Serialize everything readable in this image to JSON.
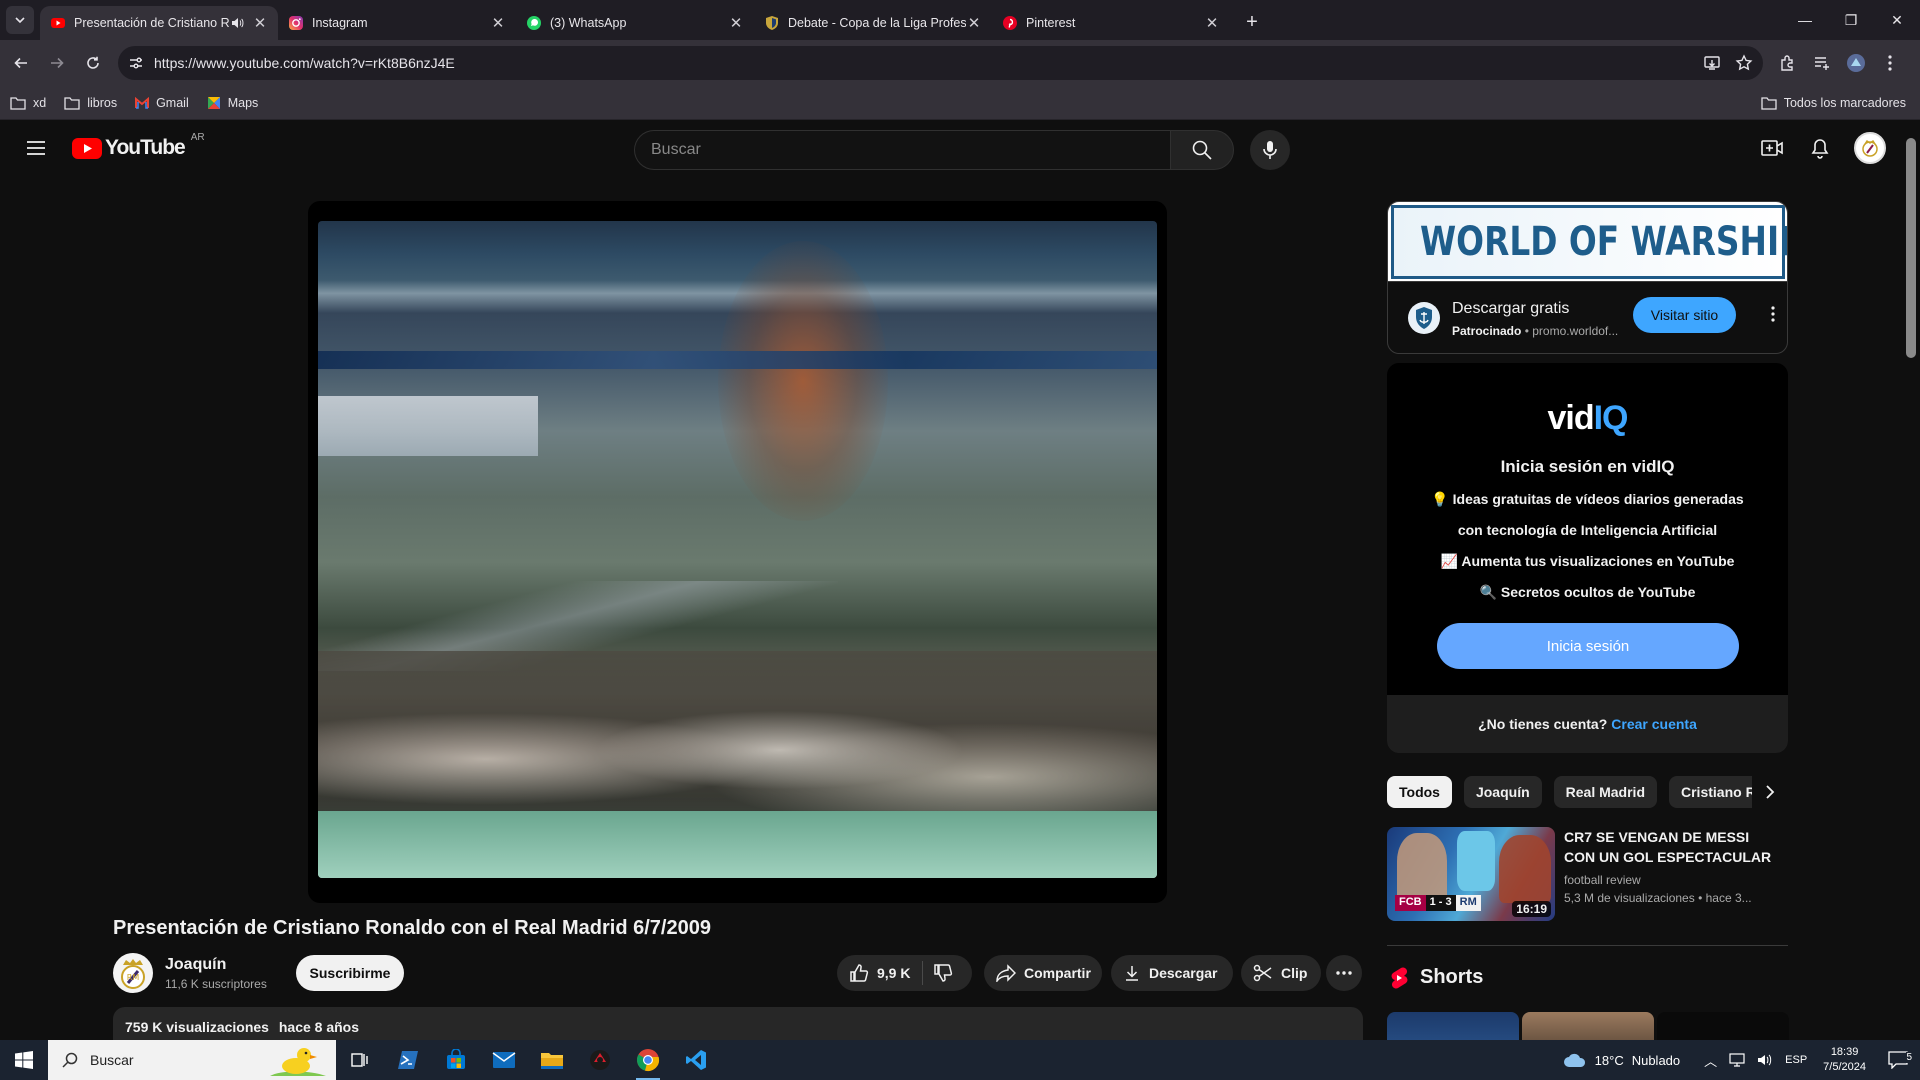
{
  "browser": {
    "tabs": [
      {
        "title": "Presentación de Cristiano Ronaldo",
        "favicon": "youtube-icon",
        "active": true,
        "audio": true
      },
      {
        "title": "Instagram",
        "favicon": "instagram-icon"
      },
      {
        "title": "(3) WhatsApp",
        "favicon": "whatsapp-icon"
      },
      {
        "title": "Debate - Copa de la Liga Profesional",
        "favicon": "shield-icon"
      },
      {
        "title": "Pinterest",
        "favicon": "pinterest-icon"
      }
    ],
    "url": "https://www.youtube.com/watch?v=rKt8B6nzJ4E",
    "bookmarks": [
      {
        "label": "xd",
        "icon": "folder-icon"
      },
      {
        "label": "libros",
        "icon": "folder-icon"
      },
      {
        "label": "Gmail",
        "icon": "gmail-icon"
      },
      {
        "label": "Maps",
        "icon": "maps-icon"
      }
    ],
    "all_bookmarks": "Todos los marcadores"
  },
  "youtube": {
    "logo_text": "YouTube",
    "country_code": "AR",
    "search_placeholder": "Buscar",
    "video": {
      "title": "Presentación de Cristiano Ronaldo con el Real Madrid 6/7/2009",
      "channel": "Joaquín",
      "subscribers": "11,6 K suscriptores",
      "subscribe_label": "Suscribirme",
      "likes": "9,9 K",
      "share_label": "Compartir",
      "download_label": "Descargar",
      "clip_label": "Clip",
      "views": "759 K visualizaciones",
      "age": "hace 8 años"
    },
    "ad": {
      "banner_text": "WORLD OF WARSHIPS",
      "title": "Descargar gratis",
      "sponsored": "Patrocinado",
      "domain": "promo.worldof...",
      "button": "Visitar sitio"
    },
    "vidiq": {
      "logo_main": "vid",
      "logo_accent": "IQ",
      "heading": "Inicia sesión en vidIQ",
      "line1": "💡 Ideas gratuitas de vídeos diarios generadas",
      "line2": "con tecnología de Inteligencia Artificial",
      "line3": "📈 Aumenta tus visualizaciones en YouTube",
      "line4": "🔍 Secretos ocultos de YouTube",
      "button": "Inicia sesión",
      "no_account": "¿No tienes cuenta?",
      "create_account": "Crear cuenta"
    },
    "chips": [
      "Todos",
      "Joaquín",
      "Real Madrid",
      "Cristiano Ro"
    ],
    "recommended": {
      "title": "CR7 SE VENGAN DE MESSI CON UN GOL ESPECTACULAR ...",
      "channel": "football review",
      "meta": "5,3 M de visualizaciones  • hace 3...",
      "duration": "16:19",
      "score_left": "FCB",
      "score": "1 - 3",
      "score_right": "RM"
    },
    "shorts_label": "Shorts"
  },
  "taskbar": {
    "search_label": "Buscar",
    "weather_temp": "18°C",
    "weather_text": "Nublado",
    "lang": "ESP",
    "time": "18:39",
    "date": "7/5/2024",
    "notifications": "5"
  }
}
